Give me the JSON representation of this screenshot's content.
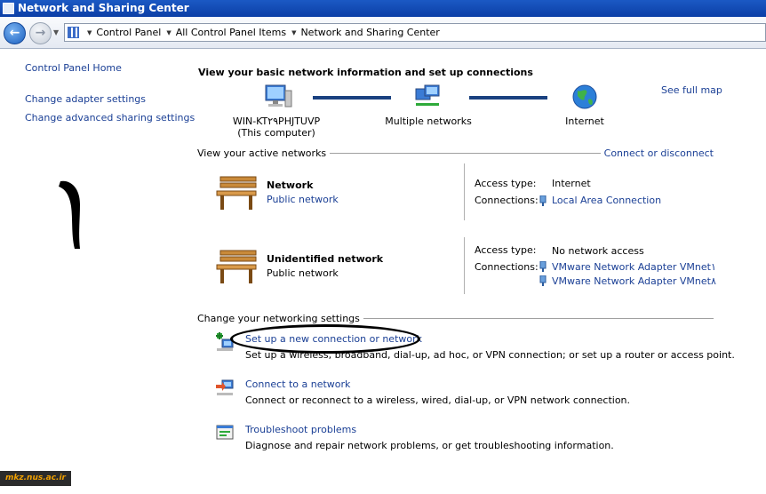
{
  "window": {
    "title": "Network and Sharing Center"
  },
  "breadcrumb": [
    "Control Panel",
    "All Control Panel Items",
    "Network and Sharing Center"
  ],
  "left_pane": {
    "home": "Control Panel Home",
    "links": [
      "Change adapter settings",
      "Change advanced sharing settings"
    ]
  },
  "annotation": {
    "number": "١"
  },
  "main": {
    "title": "View your basic network information and set up connections",
    "see_full_map": "See full map",
    "map": {
      "computer_name": "WIN-KT۲۹PHJTUVP",
      "computer_sub": "(This computer)",
      "middle": "Multiple networks",
      "right": "Internet"
    },
    "active_networks": {
      "header": "View your active networks",
      "action": "Connect or disconnect",
      "networks": [
        {
          "name": "Network",
          "type": "Public network",
          "access_label": "Access type:",
          "access_value": "Internet",
          "connections_label": "Connections:",
          "connections": [
            "Local Area Connection"
          ]
        },
        {
          "name": "Unidentified network",
          "type": "Public network",
          "access_label": "Access type:",
          "access_value": "No network access",
          "connections_label": "Connections:",
          "connections": [
            "VMware Network Adapter VMnet١",
            "VMware Network Adapter VMnet٨"
          ]
        }
      ]
    },
    "settings": {
      "header": "Change your networking settings",
      "tasks": [
        {
          "link": "Set up a new connection or network",
          "desc": "Set up a wireless, broadband, dial-up, ad hoc, or VPN connection; or set up a router or access point."
        },
        {
          "link": "Connect to a network",
          "desc": "Connect or reconnect to a wireless, wired, dial-up, or VPN network connection."
        },
        {
          "link": "Troubleshoot problems",
          "desc": "Diagnose and repair network problems, or get troubleshooting information."
        }
      ]
    }
  },
  "watermark": "mkz.nus.ac.ir"
}
